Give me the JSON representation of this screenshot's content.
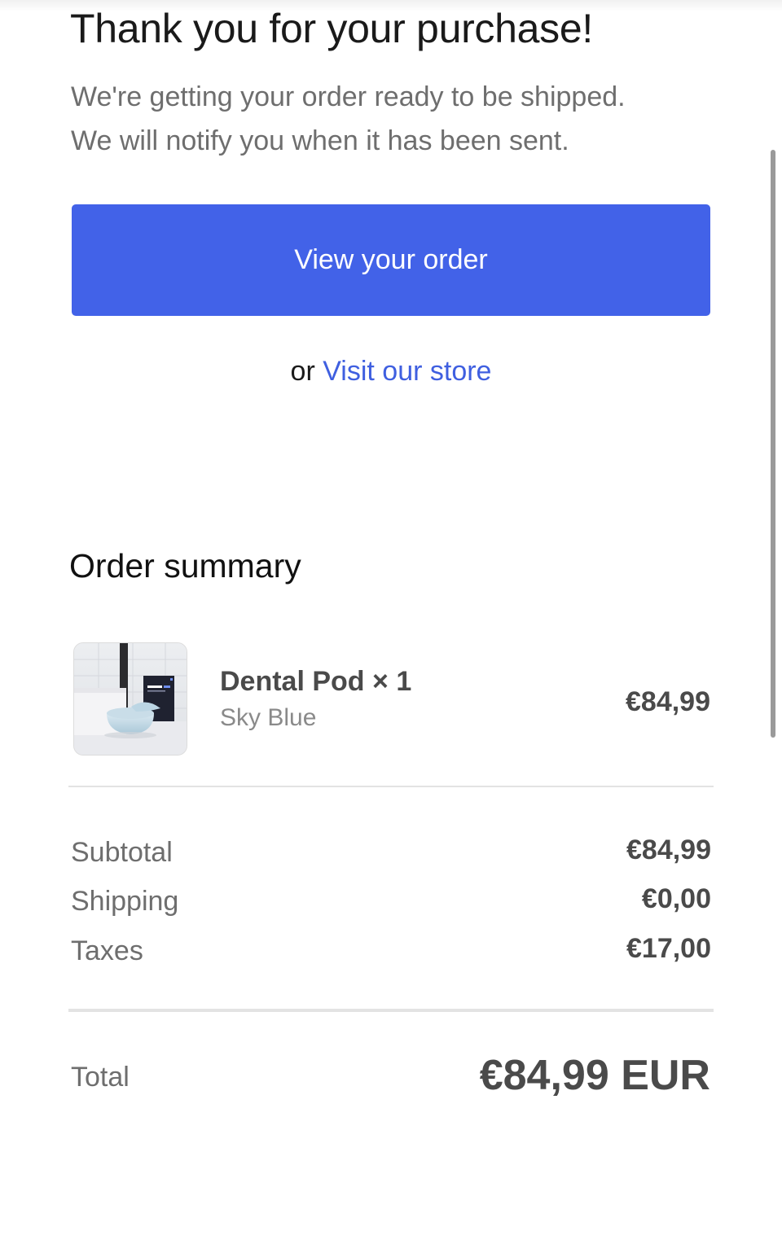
{
  "confirmation": {
    "heading": "Thank you for your purchase!",
    "message_line1": "We're getting your order ready to be shipped.",
    "message_line2": "We will notify you when it has been sent.",
    "view_order_label": "View your order",
    "or_text": "or",
    "visit_store_label": "Visit our store"
  },
  "order_summary": {
    "title": "Order summary",
    "items": [
      {
        "name": "Dental Pod × 1",
        "variant": "Sky Blue",
        "price": "€84,99",
        "thumbnail_label": "Dental pod"
      }
    ],
    "subtotal_label": "Subtotal",
    "subtotal_value": "€84,99",
    "shipping_label": "Shipping",
    "shipping_value": "€0,00",
    "taxes_label": "Taxes",
    "taxes_value": "€17,00",
    "total_label": "Total",
    "total_value": "€84,99 EUR"
  },
  "colors": {
    "accent": "#4262e8",
    "link": "#3f5fe0",
    "muted_text": "#6e6e6e",
    "value_text": "#4a4a4a"
  }
}
